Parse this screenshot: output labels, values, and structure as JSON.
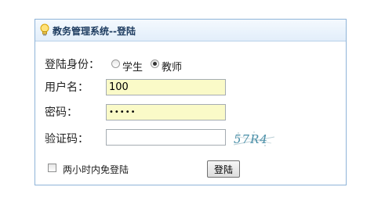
{
  "header": {
    "title": "教务管理系统--登陆",
    "icon": "lightbulb-icon"
  },
  "form": {
    "identity_label": "登陆身份：",
    "identity_options": [
      {
        "label": "学生",
        "selected": false
      },
      {
        "label": "教师",
        "selected": true
      }
    ],
    "username_label": "用户名：",
    "username_value": "100",
    "password_label": "密码：",
    "password_value": "•••••",
    "captcha_label": "验证码：",
    "captcha_value": "",
    "captcha_text": "57R4",
    "remember_label": "两小时内免登陆",
    "remember_checked": false,
    "login_button_label": "登陆"
  },
  "colors": {
    "header_bg": "#e2eefa",
    "border": "#8fb4d8",
    "autofill_bg": "#fafac8",
    "captcha_text": "#4a8fa8"
  }
}
